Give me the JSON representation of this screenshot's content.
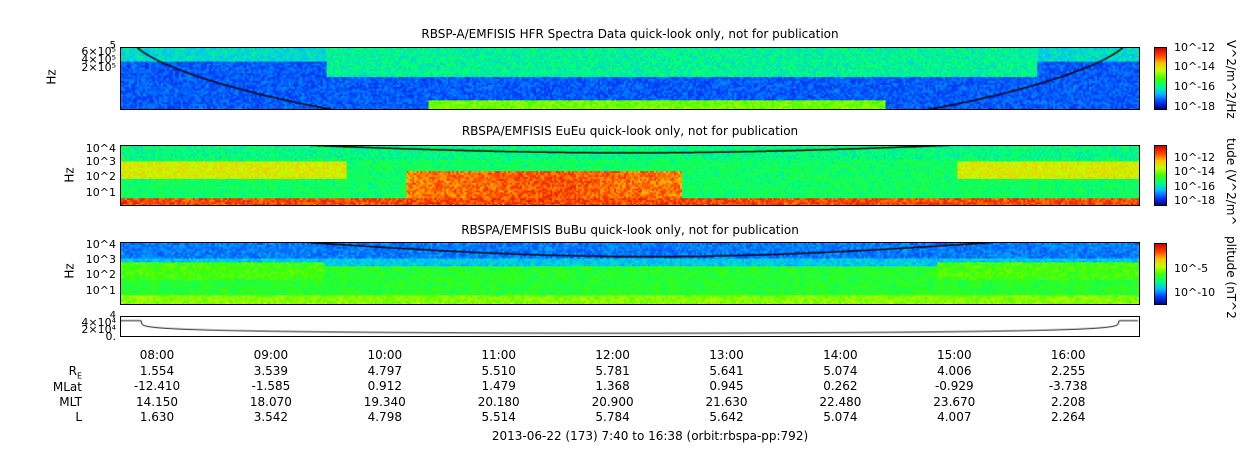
{
  "chart_data": [
    {
      "type": "heatmap",
      "title": "RBSP-A/EMFISIS  HFR Spectra Data quick-look only, not for publication",
      "ylabel": "Hz",
      "yticks": [
        "6×10⁵",
        "4×10⁵",
        "2×10⁵"
      ],
      "ytop": "5",
      "colorbar": {
        "label": "V^2/m^2/Hz",
        "ticks": [
          "10^-12",
          "10^-14",
          "10^-16",
          "10^-18"
        ]
      }
    },
    {
      "type": "heatmap",
      "title": "RBSPA/EMFISIS  EuEu quick-look only, not for publication",
      "ylabel": "Hz",
      "yticks": [
        "10^4",
        "10^3",
        "10^2",
        "10^1"
      ],
      "colorbar": {
        "label": "tude (V^2/m^",
        "ticks": [
          "10^-12",
          "10^-14",
          "10^-16",
          "10^-18"
        ]
      }
    },
    {
      "type": "heatmap",
      "title": "RBSPA/EMFISIS  BuBu quick-look only, not for publication",
      "ylabel": "Hz",
      "yticks": [
        "10^4",
        "10^3",
        "10^2",
        "10^1"
      ],
      "colorbar": {
        "label": "plitude (nT^2",
        "ticks": [
          "10^-5",
          "10^-10"
        ]
      }
    },
    {
      "type": "line",
      "yticks": [
        "4×10⁴",
        "2×10⁴",
        "0."
      ],
      "ytop": "4"
    }
  ],
  "xaxis": {
    "ticks": [
      "08:00",
      "09:00",
      "10:00",
      "11:00",
      "12:00",
      "13:00",
      "14:00",
      "15:00",
      "16:00"
    ]
  },
  "ephemeris": [
    {
      "label": "R",
      "sub": "E",
      "values": [
        "1.554",
        "3.539",
        "4.797",
        "5.510",
        "5.781",
        "5.641",
        "5.074",
        "4.006",
        "2.255"
      ]
    },
    {
      "label": "MLat",
      "values": [
        "-12.410",
        "-1.585",
        "0.912",
        "1.479",
        "1.368",
        "0.945",
        "0.262",
        "-0.929",
        "-3.738"
      ]
    },
    {
      "label": "MLT",
      "values": [
        "14.150",
        "18.070",
        "19.340",
        "20.180",
        "20.900",
        "21.630",
        "22.480",
        "23.670",
        "2.208"
      ]
    },
    {
      "label": "L",
      "values": [
        "1.630",
        "3.542",
        "4.798",
        "5.514",
        "5.784",
        "5.642",
        "5.074",
        "4.007",
        "2.264"
      ]
    }
  ],
  "footer": "2013-06-22 (173) 7:40 to 16:38 (orbit:rbspa-pp:792)"
}
